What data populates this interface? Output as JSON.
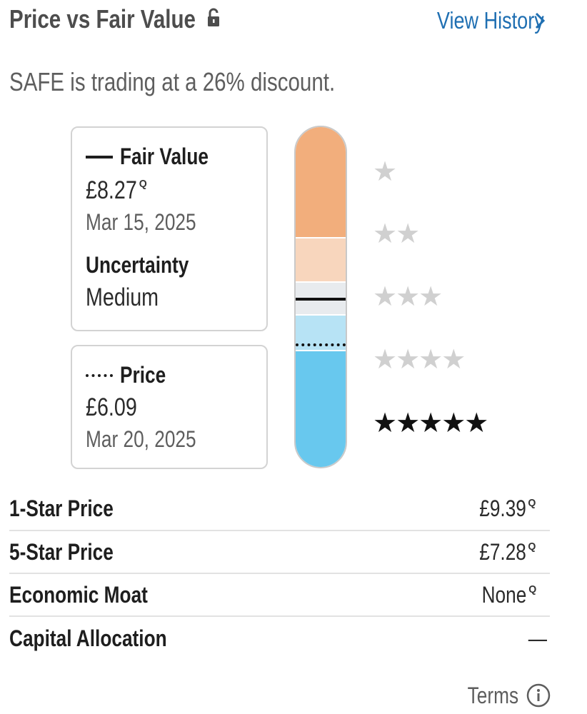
{
  "header": {
    "title": "Price vs Fair Value",
    "view_history": "View History"
  },
  "summary": "SAFE is trading at a 26% discount.",
  "fair_value_card": {
    "label": "Fair Value",
    "value": "£8.27",
    "qualifier": "Q",
    "date": "Mar 15, 2025",
    "uncertainty_label": "Uncertainty",
    "uncertainty_value": "Medium"
  },
  "price_card": {
    "label": "Price",
    "value": "£6.09",
    "date": "Mar 20, 2025"
  },
  "rating_scale": {
    "levels": [
      {
        "stars": 1,
        "symbols": "★",
        "active": false
      },
      {
        "stars": 2,
        "symbols": "★★",
        "active": false
      },
      {
        "stars": 3,
        "symbols": "★★★",
        "active": false
      },
      {
        "stars": 4,
        "symbols": "★★★★",
        "active": false
      },
      {
        "stars": 5,
        "symbols": "★★★★★",
        "active": true
      }
    ],
    "colors": {
      "one_star": "#f2ae7c",
      "two_star": "#f8d6bd",
      "three_star": "#e8ebee",
      "four_star": "#b7e3f5",
      "five_star": "#68c8ee"
    }
  },
  "metrics": [
    {
      "label": "1-Star Price",
      "value": "£9.39",
      "qualifier": "Q"
    },
    {
      "label": "5-Star Price",
      "value": "£7.28",
      "qualifier": "Q"
    },
    {
      "label": "Economic Moat",
      "value": "None",
      "qualifier": "Q"
    },
    {
      "label": "Capital Allocation",
      "value": "—",
      "qualifier": ""
    }
  ],
  "footer": {
    "terms": "Terms",
    "info_icon": "info-circle-icon"
  },
  "icons": {
    "lock": "unlock-icon",
    "chevron": "chevron-right-icon"
  },
  "colors": {
    "link": "#1f6fb2",
    "text": "#1e1e1e",
    "muted": "#5e5e5e"
  }
}
